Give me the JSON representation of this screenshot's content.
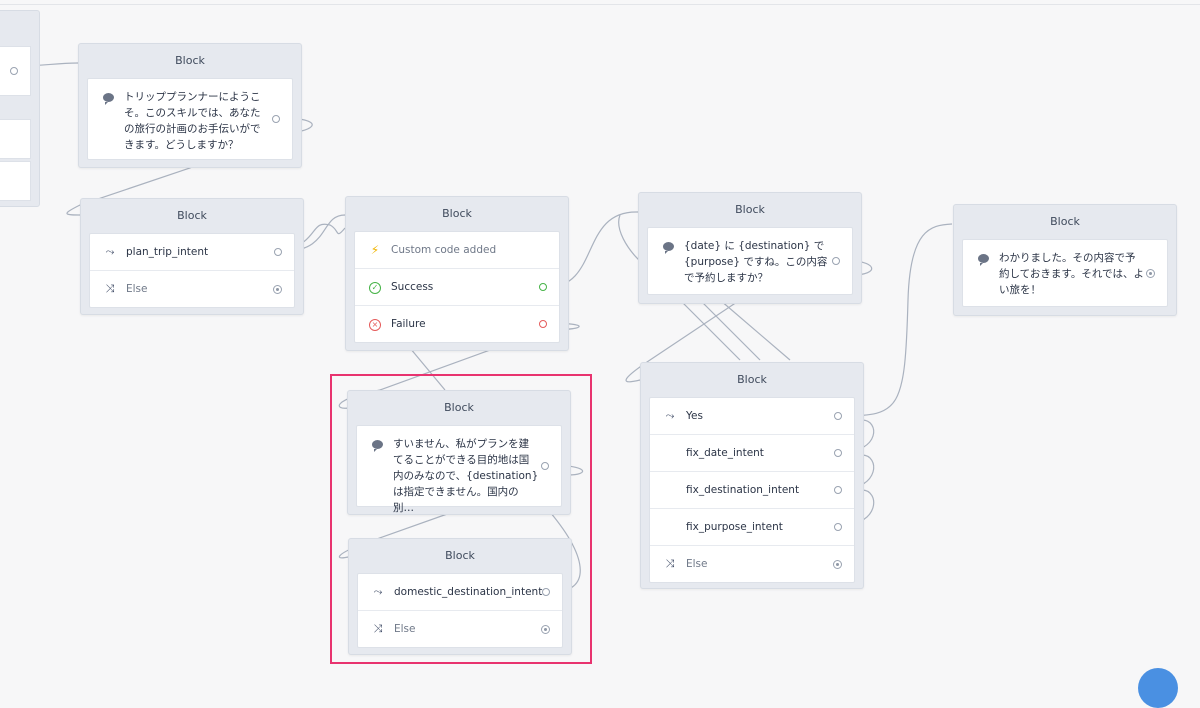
{
  "colors": {
    "highlight": "#e8336f",
    "success": "#46b347",
    "failure": "#e55b5b",
    "bolt": "#f0b400",
    "fab": "#4a90e2"
  },
  "blocks": {
    "welcome": {
      "title": "Block",
      "message": "トリッププランナーにようこそ。このスキルでは、あなたの旅行の計画のお手伝いができます。どうしますか？",
      "icon": "chat-bubble-icon"
    },
    "intent": {
      "title": "Block",
      "rows": [
        {
          "label": "plan_trip_intent",
          "icon": "intent-branch-icon"
        },
        {
          "label": "Else",
          "icon": "shuffle-icon"
        }
      ]
    },
    "code": {
      "title": "Block",
      "rows": [
        {
          "label": "Custom code added",
          "icon": "lightning-icon"
        },
        {
          "label": "Success",
          "icon": "check-circle-icon"
        },
        {
          "label": "Failure",
          "icon": "x-circle-icon"
        }
      ]
    },
    "confirm": {
      "title": "Block",
      "message": "{date} に {destination} で {purpose} ですね。この内容で予約しますか？",
      "icon": "chat-bubble-icon"
    },
    "final": {
      "title": "Block",
      "message": "わかりました。その内容で予約しておきます。それでは、よい旅を！",
      "icon": "chat-bubble-icon"
    },
    "sorry": {
      "title": "Block",
      "message": "すいません、私がプランを建てることができる目的地は国内のみなので、{destination} は指定できません。国内の別…",
      "icon": "chat-bubble-icon"
    },
    "domestic": {
      "title": "Block",
      "rows": [
        {
          "label": "domestic_destination_intent",
          "icon": "intent-branch-icon"
        },
        {
          "label": "Else",
          "icon": "shuffle-icon"
        }
      ]
    },
    "yes": {
      "title": "Block",
      "rows": [
        {
          "label": "Yes",
          "icon": "intent-branch-icon"
        },
        {
          "label": "fix_date_intent"
        },
        {
          "label": "fix_destination_intent"
        },
        {
          "label": "fix_purpose_intent"
        },
        {
          "label": "Else",
          "icon": "shuffle-icon"
        }
      ]
    }
  }
}
